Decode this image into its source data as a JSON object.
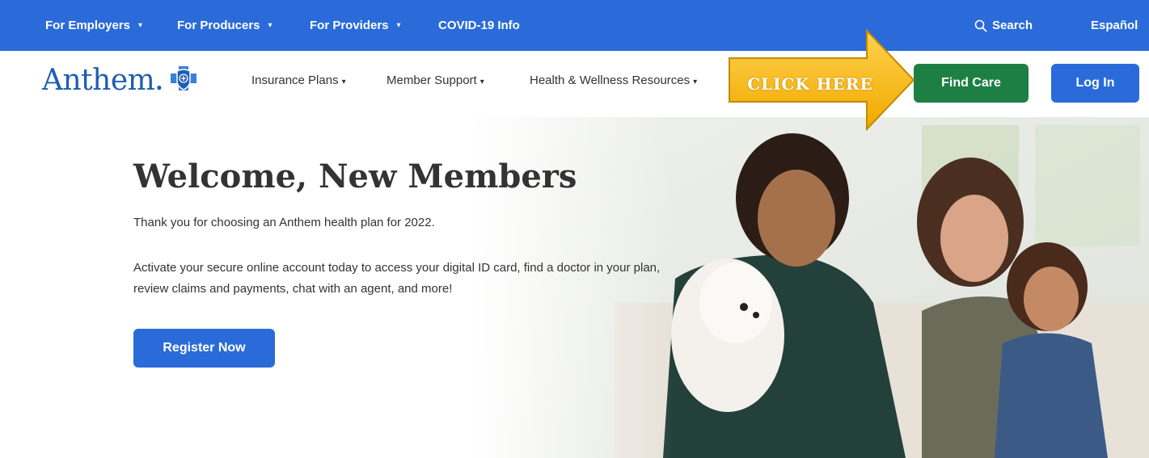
{
  "topbar": {
    "background": "#2A6BD9",
    "links": [
      {
        "label": "For Employers"
      },
      {
        "label": "For Producers"
      },
      {
        "label": "For Providers"
      },
      {
        "label": "COVID-19 Info"
      }
    ],
    "search_label": "Search",
    "search_icon": "search-icon",
    "language_label": "Español"
  },
  "nav": {
    "logo_text": "Anthem",
    "logo_icon": "blue-cross-blue-shield-icon",
    "items": [
      {
        "label": "Insurance Plans"
      },
      {
        "label": "Member Support"
      },
      {
        "label": "Health & Wellness Resources"
      }
    ],
    "find_care_label": "Find Care",
    "find_care_color": "#1E7F45",
    "login_label": "Log In"
  },
  "callout": {
    "label": "CLICK HERE",
    "color": "#F5B800"
  },
  "hero": {
    "title": "Welcome, New Members",
    "subtitle": "Thank you for choosing an Anthem health plan for 2022.",
    "body": "Activate your secure online account today to access your digital ID card, find a doctor in your plan, review claims and payments, chat with an agent, and more!",
    "register_label": "Register Now"
  }
}
